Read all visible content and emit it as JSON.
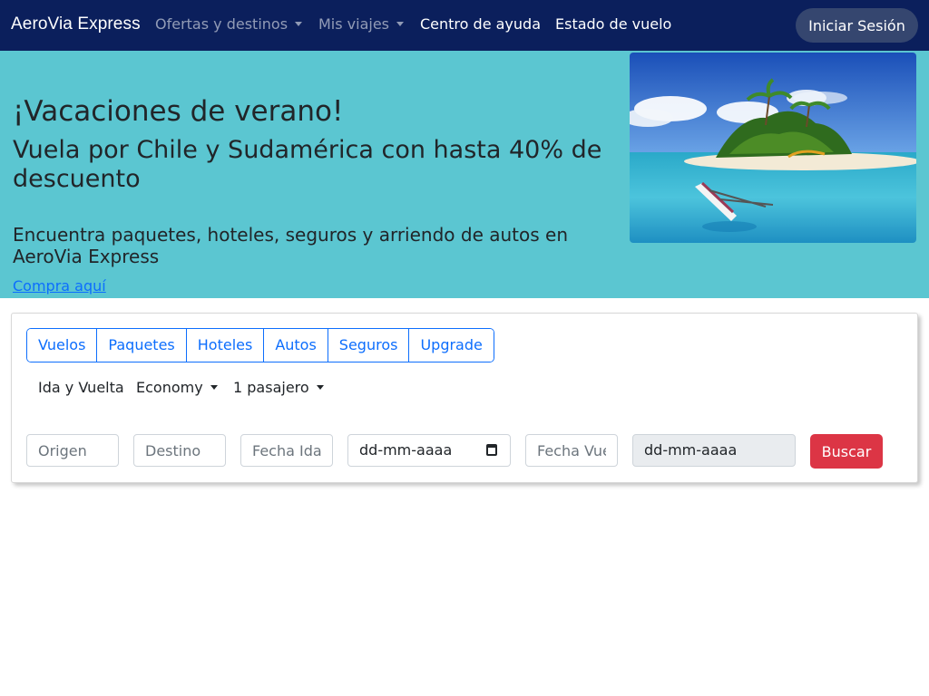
{
  "navbar": {
    "brand": "AeroVia Express",
    "items": [
      {
        "label": "Ofertas y destinos",
        "dropdown": true
      },
      {
        "label": "Mis viajes",
        "dropdown": true
      },
      {
        "label": "Centro de ayuda",
        "dropdown": false
      },
      {
        "label": "Estado de vuelo",
        "dropdown": false
      }
    ],
    "login_label": "Iniciar Sesión"
  },
  "hero": {
    "title": "¡Vacaciones de verano!",
    "subtitle": "Vuela por Chile y Sudamérica con hasta 40% de descuento",
    "description": "Encuentra paquetes, hoteles, seguros y arriendo de autos en AeroVia Express",
    "link_label": "Compra aquí",
    "image": "tropical-island-beach-photo"
  },
  "search": {
    "tabs": [
      "Vuelos",
      "Paquetes",
      "Hoteles",
      "Autos",
      "Seguros",
      "Upgrade"
    ],
    "trip_type": "Ida y Vuelta",
    "cabin_class": "Economy",
    "passengers": "1 pasajero",
    "origin_placeholder": "Origen",
    "destination_placeholder": "Destino",
    "departure_label_placeholder": "Fecha Ida",
    "departure_date": "dd-mm-aaaa",
    "return_label_placeholder": "Fecha Vuelta",
    "return_date": "dd-mm-aaaa",
    "search_button": "Buscar"
  },
  "colors": {
    "navbar_bg": "#0b1f5c",
    "hero_bg": "#5bc6d1",
    "primary": "#0d6efd",
    "danger": "#dc3545"
  }
}
